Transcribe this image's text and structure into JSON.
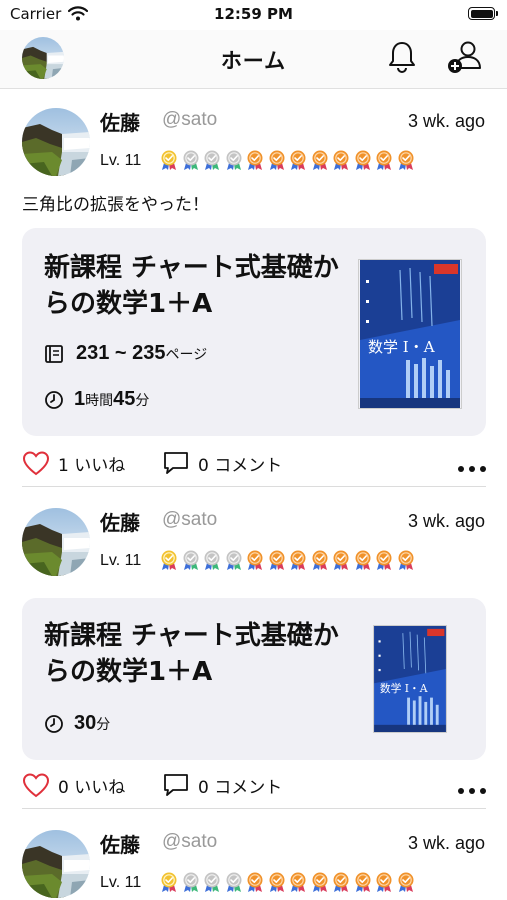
{
  "status": {
    "carrier": "Carrier",
    "time": "12:59 PM"
  },
  "nav": {
    "title": "ホーム"
  },
  "posts": [
    {
      "name": "佐藤",
      "handle": "@sato",
      "ago": "3 wk. ago",
      "level": "Lv. 11",
      "caption": "三角比の拡張をやった！",
      "book_title": "新課程 チャート式基礎からの数学1＋A",
      "pages": "231 ~ 235",
      "pages_unit": "ページ",
      "hours": "1",
      "hours_unit": "時間",
      "minutes": "45",
      "minutes_unit": "分",
      "likes": "1 いいね",
      "comments": "0 コメント"
    },
    {
      "name": "佐藤",
      "handle": "@sato",
      "ago": "3 wk. ago",
      "level": "Lv. 11",
      "book_title": "新課程 チャート式基礎からの数学1＋A",
      "minutes": "30",
      "minutes_unit": "分",
      "likes": "0 いいね",
      "comments": "0 コメント"
    },
    {
      "name": "佐藤",
      "handle": "@sato",
      "ago": "3 wk. ago",
      "level": "Lv. 11"
    }
  ],
  "medals": [
    "gold",
    "silver",
    "silver",
    "silver",
    "bronze",
    "bronze",
    "bronze",
    "bronze",
    "bronze",
    "bronze",
    "bronze",
    "bronze"
  ],
  "colors": {
    "gold": "#f2c230",
    "silver": "#c4c4c4",
    "bronze": "#f0922b",
    "like": "#e0303b",
    "card": "#f0f0f5"
  },
  "icons": {
    "bell": "bell-icon",
    "add_user": "add-user-icon",
    "book": "book-icon",
    "clock": "clock-icon",
    "heart": "heart-icon",
    "comment": "comment-icon",
    "more": "more-icon"
  }
}
